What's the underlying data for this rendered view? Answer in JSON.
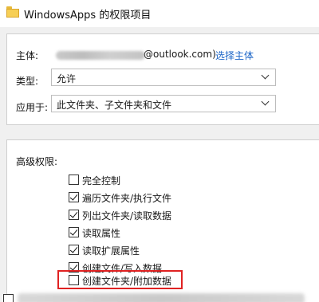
{
  "window": {
    "title": "WindowsApps 的权限项目"
  },
  "principal": {
    "label": "主体:",
    "value_suffix": "@outlook.com)",
    "change_link": "选择主体"
  },
  "type": {
    "label": "类型:",
    "value": "允许"
  },
  "applies_to": {
    "label": "应用于:",
    "value": "此文件夹、子文件夹和文件"
  },
  "advanced": {
    "title": "高级权限:",
    "permissions": [
      {
        "label": "完全控制",
        "checked": false
      },
      {
        "label": "遍历文件夹/执行文件",
        "checked": true
      },
      {
        "label": "列出文件夹/读取数据",
        "checked": true
      },
      {
        "label": "读取属性",
        "checked": true
      },
      {
        "label": "读取扩展属性",
        "checked": true
      },
      {
        "label": "创建文件/写入数据",
        "checked": true
      },
      {
        "label": "创建文件夹/附加数据",
        "checked": false
      }
    ]
  },
  "colors": {
    "link": "#1a64c7",
    "highlight": "#e02222"
  }
}
